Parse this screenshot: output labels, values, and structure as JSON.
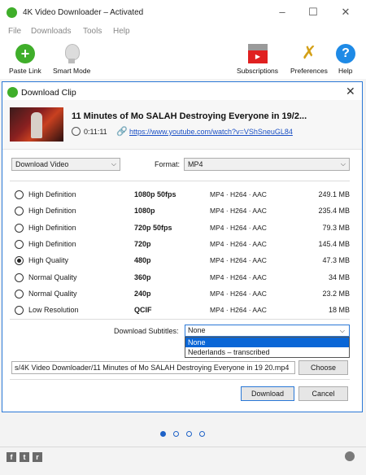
{
  "window": {
    "title": "4K Video Downloader – Activated",
    "controls": [
      "–",
      "☐",
      "✕"
    ]
  },
  "menu": [
    "File",
    "Downloads",
    "Tools",
    "Help"
  ],
  "toolbar": {
    "paste_link": "Paste Link",
    "smart_mode": "Smart Mode",
    "subscriptions": "Subscriptions",
    "preferences": "Preferences",
    "help": "Help"
  },
  "dialog": {
    "title": "Download Clip",
    "close": "✕",
    "clip": {
      "title": "11 Minutes of Mo SALAH Destroying Everyone in 19/2...",
      "duration": "0:11:11",
      "url": "https://www.youtube.com/watch?v=VShSneuGL84"
    },
    "type_select": "Download Video",
    "format_label": "Format:",
    "format_select": "MP4",
    "rows": [
      {
        "label": "High Definition",
        "res": "1080p 50fps",
        "codec": "MP4 · H264 · AAC",
        "size": "249.1 MB",
        "checked": false
      },
      {
        "label": "High Definition",
        "res": "1080p",
        "codec": "MP4 · H264 · AAC",
        "size": "235.4 MB",
        "checked": false
      },
      {
        "label": "High Definition",
        "res": "720p 50fps",
        "codec": "MP4 · H264 · AAC",
        "size": "79.3 MB",
        "checked": false
      },
      {
        "label": "High Definition",
        "res": "720p",
        "codec": "MP4 · H264 · AAC",
        "size": "145.4 MB",
        "checked": false
      },
      {
        "label": "High Quality",
        "res": "480p",
        "codec": "MP4 · H264 · AAC",
        "size": "47.3 MB",
        "checked": true
      },
      {
        "label": "Normal Quality",
        "res": "360p",
        "codec": "MP4 · H264 · AAC",
        "size": "34 MB",
        "checked": false
      },
      {
        "label": "Normal Quality",
        "res": "240p",
        "codec": "MP4 · H264 · AAC",
        "size": "23.2 MB",
        "checked": false
      },
      {
        "label": "Low Resolution",
        "res": "QCIF",
        "codec": "MP4 · H264 · AAC",
        "size": "18 MB",
        "checked": false
      }
    ],
    "subtitles_label": "Download Subtitles:",
    "subtitles_value": "None",
    "subtitles_options": [
      "None",
      "Nederlands – transcribed"
    ],
    "path": "s/4K Video Downloader/11 Minutes of Mo SALAH Destroying Everyone in 19 20.mp4",
    "choose": "Choose",
    "download": "Download",
    "cancel": "Cancel"
  },
  "pager": {
    "count": 4,
    "active": 0
  },
  "footer": {
    "social": [
      "f",
      "t",
      "r"
    ]
  },
  "colors": {
    "accent": "#2a78d6",
    "brand_green": "#3fae2a",
    "selected": "#0a66d6"
  }
}
